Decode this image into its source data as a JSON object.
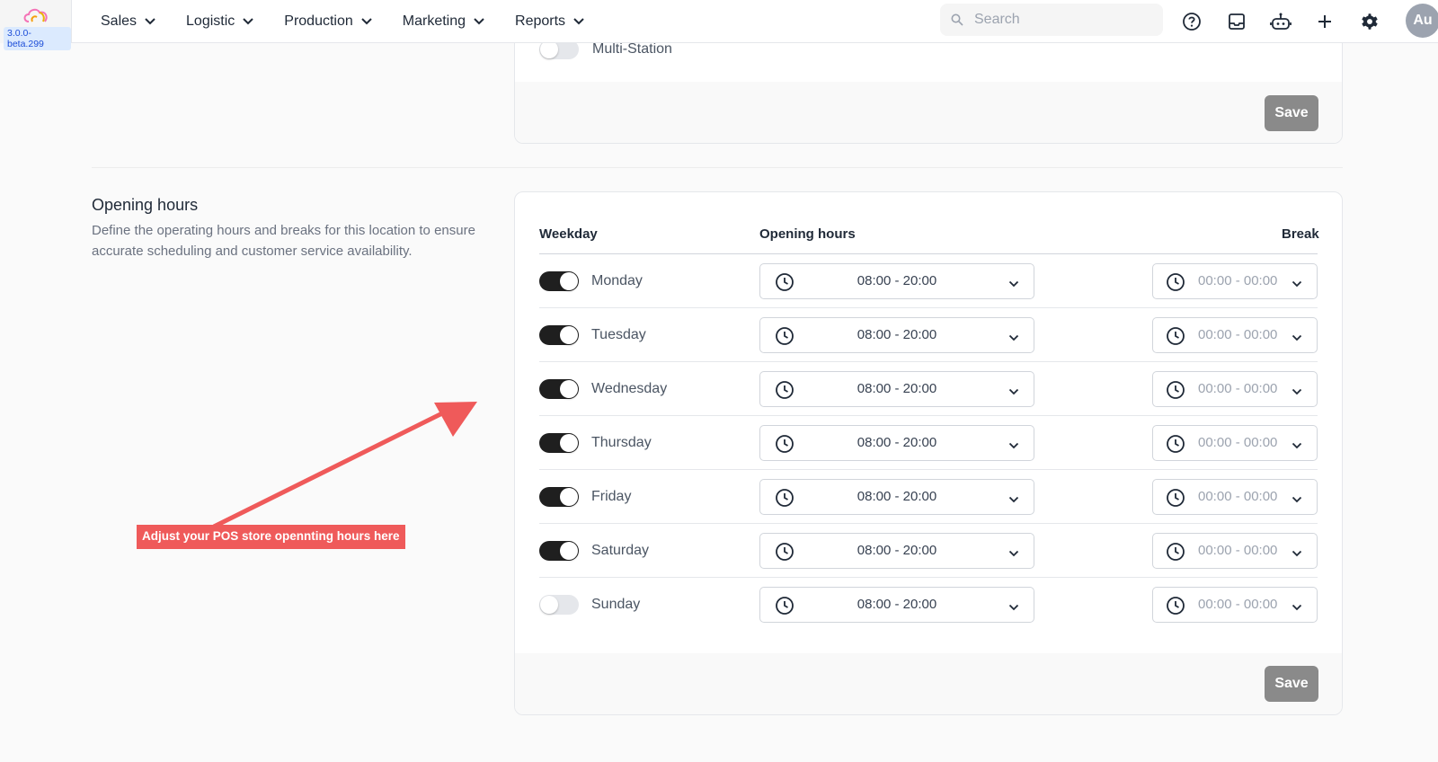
{
  "app": {
    "version": "3.0.0-beta.299",
    "nav": [
      {
        "label": "Sales"
      },
      {
        "label": "Logistic"
      },
      {
        "label": "Production"
      },
      {
        "label": "Marketing"
      },
      {
        "label": "Reports"
      }
    ],
    "search": {
      "placeholder": "Search"
    },
    "avatar_initials": "Au",
    "icons": [
      "help-circle-icon",
      "inbox-icon",
      "bot-icon",
      "plus-icon",
      "gear-icon"
    ]
  },
  "top_card": {
    "toggle_label": "Multi-Station",
    "toggle_on": false,
    "save_label": "Save"
  },
  "opening_hours": {
    "title": "Opening hours",
    "description": "Define the operating hours and breaks for this location to ensure accurate scheduling and customer service availability.",
    "headers": {
      "weekday": "Weekday",
      "opening": "Opening hours",
      "break": "Break"
    },
    "days": [
      {
        "name": "Monday",
        "enabled": true,
        "hours": "08:00 - 20:00",
        "break": "00:00 - 00:00"
      },
      {
        "name": "Tuesday",
        "enabled": true,
        "hours": "08:00 - 20:00",
        "break": "00:00 - 00:00"
      },
      {
        "name": "Wednesday",
        "enabled": true,
        "hours": "08:00 - 20:00",
        "break": "00:00 - 00:00"
      },
      {
        "name": "Thursday",
        "enabled": true,
        "hours": "08:00 - 20:00",
        "break": "00:00 - 00:00"
      },
      {
        "name": "Friday",
        "enabled": true,
        "hours": "08:00 - 20:00",
        "break": "00:00 - 00:00"
      },
      {
        "name": "Saturday",
        "enabled": true,
        "hours": "08:00 - 20:00",
        "break": "00:00 - 00:00"
      },
      {
        "name": "Sunday",
        "enabled": false,
        "hours": "08:00 - 20:00",
        "break": "00:00 - 00:00"
      }
    ],
    "save_label": "Save"
  },
  "annotation": {
    "text": "Adjust your POS store opennting hours here",
    "color": "#ef5a5a"
  }
}
